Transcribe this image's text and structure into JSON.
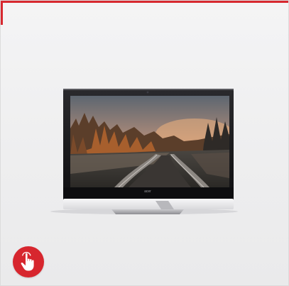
{
  "card": {
    "accent_color": "#d7282f",
    "background_color": "#efeff0"
  },
  "product": {
    "image_icon": "touchscreen-monitor-image",
    "brand_mark": "acer"
  },
  "badge": {
    "icon": "hand-tap-icon",
    "color": "#d7262e"
  }
}
